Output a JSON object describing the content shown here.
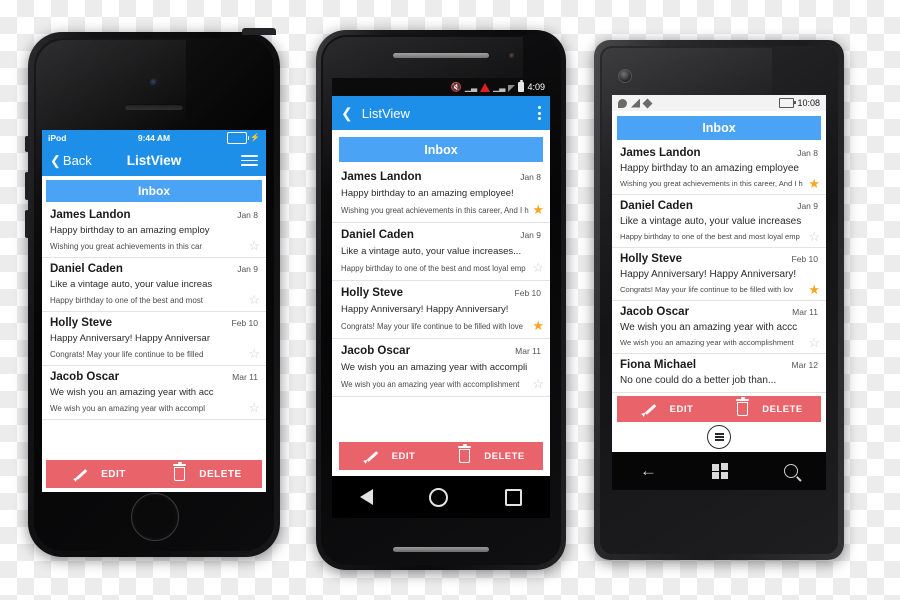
{
  "colors": {
    "accent_blue": "#1d8fe8",
    "inbox_blue": "#4aa3f5",
    "action_red": "#e8646a",
    "star_on": "#f6a623",
    "star_off": "#cdcdcd"
  },
  "shared": {
    "inbox_label": "Inbox",
    "edit_label": "EDIT",
    "delete_label": "DELETE",
    "star_on_glyph": "★",
    "star_off_glyph": "☆"
  },
  "iphone": {
    "status": {
      "carrier": "iPod",
      "time": "9:44 AM"
    },
    "navbar": {
      "back_label": "Back",
      "title": "ListView"
    },
    "mails": [
      {
        "name": "James Landon",
        "date": "Jan 8",
        "subject": "Happy birthday to an amazing employ",
        "preview": "Wishing you great achievements in this car",
        "starred": false
      },
      {
        "name": "Daniel Caden",
        "date": "Jan 9",
        "subject": "Like a vintage auto, your value increas",
        "preview": "Happy birthday to one of the best and most",
        "starred": false
      },
      {
        "name": "Holly Steve",
        "date": "Feb 10",
        "subject": "Happy Anniversary! Happy Anniversar",
        "preview": "Congrats! May your life continue to be filled",
        "starred": false
      },
      {
        "name": "Jacob Oscar",
        "date": "Mar 11",
        "subject": "We wish you an amazing year with acc",
        "preview": "We wish you an amazing year with accompl",
        "starred": false
      }
    ]
  },
  "android": {
    "status": {
      "time": "4:09"
    },
    "appbar": {
      "title": "ListView"
    },
    "mails": [
      {
        "name": "James Landon",
        "date": "Jan 8",
        "subject": "Happy birthday to an amazing employee!",
        "preview": "Wishing you great achievements in this career, And I h",
        "starred": true
      },
      {
        "name": "Daniel Caden",
        "date": "Jan 9",
        "subject": "Like a vintage auto, your value increases...",
        "preview": "Happy birthday to one of the best and most loyal emp",
        "starred": false
      },
      {
        "name": "Holly Steve",
        "date": "Feb 10",
        "subject": "Happy Anniversary! Happy Anniversary!",
        "preview": "Congrats! May your life continue to be filled with love",
        "starred": true
      },
      {
        "name": "Jacob Oscar",
        "date": "Mar 11",
        "subject": "We wish you an amazing year with accompli",
        "preview": "We wish you an amazing year with accomplishment",
        "starred": false
      }
    ]
  },
  "winphone": {
    "status": {
      "time": "10:08"
    },
    "mails": [
      {
        "name": "James Landon",
        "date": "Jan 8",
        "subject": "Happy birthday to an amazing employee",
        "preview": "Wishing you great achievements in this career, And I h",
        "starred": true
      },
      {
        "name": "Daniel Caden",
        "date": "Jan 9",
        "subject": "Like a vintage auto, your value increases",
        "preview": "Happy birthday to one of the best and most loyal emp",
        "starred": false
      },
      {
        "name": "Holly Steve",
        "date": "Feb 10",
        "subject": "Happy Anniversary! Happy Anniversary!",
        "preview": "Congrats! May your life continue to be filled with lov",
        "starred": true
      },
      {
        "name": "Jacob Oscar",
        "date": "Mar 11",
        "subject": "We wish you an amazing year with accc",
        "preview": "We wish you an amazing year with accomplishment",
        "starred": false
      },
      {
        "name": "Fiona Michael",
        "date": "Mar 12",
        "subject": "No one could do a better job than...",
        "preview": "",
        "starred": false
      }
    ]
  }
}
